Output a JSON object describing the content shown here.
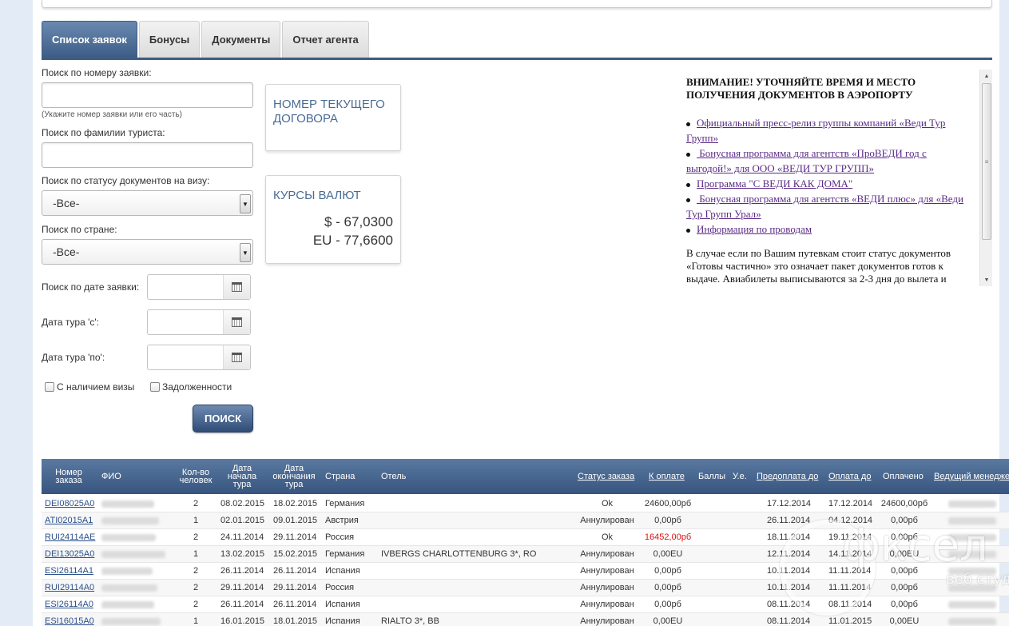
{
  "tabs": [
    {
      "label": "Список заявок",
      "active": true
    },
    {
      "label": "Бонусы",
      "active": false
    },
    {
      "label": "Документы",
      "active": false
    },
    {
      "label": "Отчет агента",
      "active": false
    }
  ],
  "search": {
    "order_number_label": "Поиск по номеру заявки:",
    "order_number_hint": "(Укажите номер заявки или его часть)",
    "surname_label": "Поиск по фамилии туриста:",
    "visa_status_label": "Поиск по статусу документов на визу:",
    "visa_status_value": "-Все-",
    "country_label": "Поиск по стране:",
    "country_value": "-Все-",
    "order_date_label": "Поиск по дате заявки:",
    "tour_from_label": "Дата тура 'с':",
    "tour_to_label": "Дата тура 'по':",
    "with_visa_label": "С наличием визы",
    "debts_label": "Задолженности",
    "search_button": "ПОИСК"
  },
  "contract_box": {
    "title": "НОМЕР ТЕКУЩЕГО ДОГОВОРА"
  },
  "currency_box": {
    "title": "КУРСЫ ВАЛЮТ",
    "usd": "$ - 67,0300",
    "eur": "EU - 77,6600"
  },
  "news": {
    "heading": "ВНИМАНИЕ! УТОЧНЯЙТЕ ВРЕМЯ И МЕСТО ПОЛУЧЕНИЯ ДОКУМЕНТОВ В АЭРОПОРТУ",
    "links": [
      "Официальный пресс-релиз группы компаний «Веди Тур Групп»",
      " Бонусная программа для агентств «ПроВЕДИ год с выгодой!» для ООО «ВЕДИ ТУР ГРУПП»",
      "Программа \"С ВЕДИ КАК ДОМА\"",
      " Бонусная программа для агентств «ВЕДИ плюс» для «Веди Тур Групп Урал»",
      "Информация по проводам"
    ],
    "paragraph": "В случае если по Вашим путевкам стоит статус документов «Готовы частично» это означает пакет документов готов к выдаче. Авиабилеты выписываются за 2-3 дня до вылета и"
  },
  "table": {
    "headers": {
      "order": "Номер заказа",
      "fio": "ФИО",
      "count": "Кол-во человек",
      "start": "Дата начала тура",
      "end": "Дата окончания тура",
      "country": "Страна",
      "hotel": "Отель",
      "status": "Статус заказа",
      "to_pay": "К оплате",
      "points": "Баллы",
      "ue": "У.е.",
      "prepay": "Предоплата до",
      "pay_until": "Оплата до",
      "paid": "Оплачено",
      "manager": "Ведущий менеджер"
    },
    "rows": [
      {
        "order": "DEI08025A0",
        "count": "2",
        "start": "08.02.2015",
        "end": "18.02.2015",
        "country": "Германия",
        "hotel": "",
        "status": "Ok",
        "to_pay": "24600,00рб",
        "prepay": "17.12.2014",
        "pay_until": "17.12.2014",
        "paid": "24600,00рб"
      },
      {
        "order": "ATI02015A1",
        "count": "1",
        "start": "02.01.2015",
        "end": "09.01.2015",
        "country": "Австрия",
        "hotel": "",
        "status": "Аннулирован",
        "to_pay": "0,00рб",
        "prepay": "26.11.2014",
        "pay_until": "04.12.2014",
        "paid": "0,00рб"
      },
      {
        "order": "RUI24114AE",
        "count": "2",
        "start": "24.11.2014",
        "end": "29.11.2014",
        "country": "Россия",
        "hotel": "",
        "status": "Ok",
        "to_pay": "16452,00рб",
        "prepay": "18.11.2014",
        "pay_until": "19.11.2014",
        "paid": "0,00рб"
      },
      {
        "order": "DEI13025A0",
        "count": "1",
        "start": "13.02.2015",
        "end": "15.02.2015",
        "country": "Германия",
        "hotel": "IVBERGS CHARLOTTENBURG 3*, RO",
        "status": "Аннулирован",
        "to_pay": "0,00EU",
        "prepay": "12.11.2014",
        "pay_until": "14.11.2014",
        "paid": "0,00EU"
      },
      {
        "order": "ESI26114A1",
        "count": "2",
        "start": "26.11.2014",
        "end": "26.11.2014",
        "country": "Испания",
        "hotel": "",
        "status": "Аннулирован",
        "to_pay": "0,00рб",
        "prepay": "10.11.2014",
        "pay_until": "11.11.2014",
        "paid": "0,00рб"
      },
      {
        "order": "RUI29114A0",
        "count": "2",
        "start": "29.11.2014",
        "end": "29.11.2014",
        "country": "Россия",
        "hotel": "",
        "status": "Аннулирован",
        "to_pay": "0,00рб",
        "prepay": "10.11.2014",
        "pay_until": "11.11.2014",
        "paid": "0,00рб"
      },
      {
        "order": "ESI26114A0",
        "count": "2",
        "start": "26.11.2014",
        "end": "26.11.2014",
        "country": "Испания",
        "hotel": "",
        "status": "Аннулирован",
        "to_pay": "0,00рб",
        "prepay": "08.11.2014",
        "pay_until": "08.11.2014",
        "paid": "0,00рб"
      },
      {
        "order": "ESI16015A0",
        "count": "1",
        "start": "16.01.2015",
        "end": "18.01.2015",
        "country": "Испания",
        "hotel": "RIALTO 3*, BB",
        "status": "Аннулирован",
        "to_pay": "0,00EU",
        "prepay": "08.11.2014",
        "pay_until": "11.01.2015",
        "paid": "0,00EU"
      }
    ]
  },
  "watermark": {
    "word": "фксел",
    "sub": "веб студия"
  },
  "colors": {
    "accent": "#3e5d86",
    "link": "#5a2a86",
    "alert": "#dd1111",
    "background": "#e2ebf6"
  }
}
